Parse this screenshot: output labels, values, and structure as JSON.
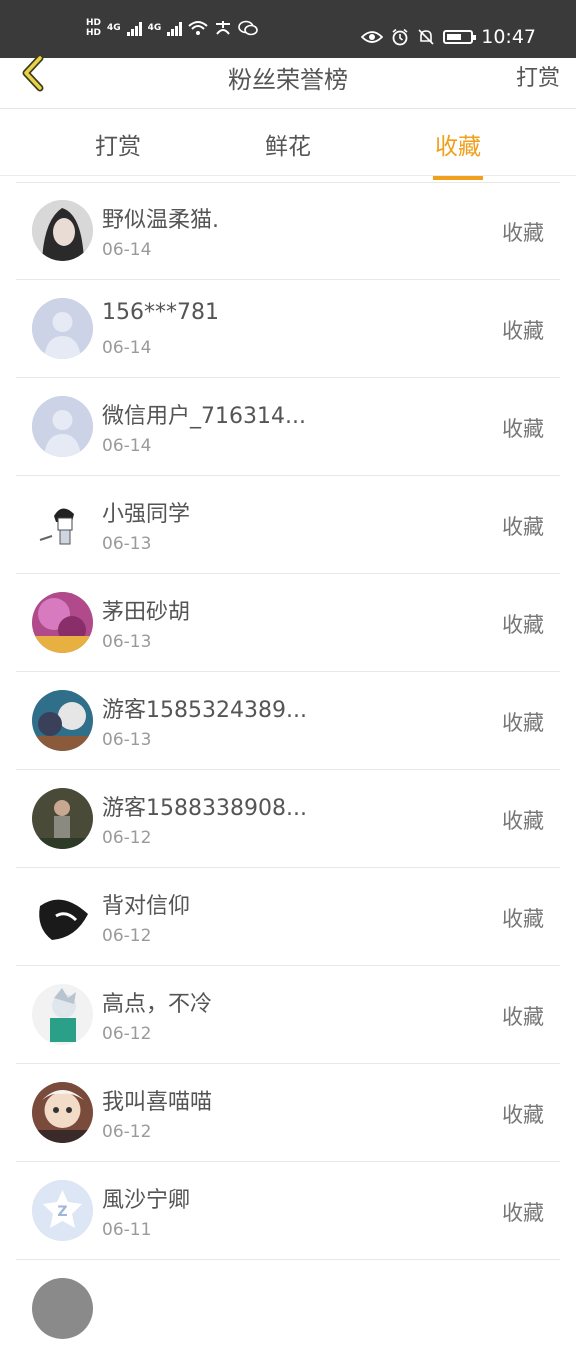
{
  "status_bar": {
    "hd_top": "HD",
    "hd_bottom": "HD",
    "net1": "4G",
    "net2": "4G",
    "time": "10:47"
  },
  "header": {
    "title": "粉丝荣誉榜",
    "action": "打赏"
  },
  "tabs": [
    {
      "label": "打赏",
      "active": false
    },
    {
      "label": "鲜花",
      "active": false
    },
    {
      "label": "收藏",
      "active": true
    }
  ],
  "list": [
    {
      "name": "野似温柔猫.",
      "date": "06-14",
      "action": "收藏"
    },
    {
      "name": "156***781",
      "date": "06-14",
      "action": "收藏"
    },
    {
      "name": "微信用户_716314...",
      "date": "06-14",
      "action": "收藏"
    },
    {
      "name": "小强同学",
      "date": "06-13",
      "action": "收藏"
    },
    {
      "name": "茅田砂胡",
      "date": "06-13",
      "action": "收藏"
    },
    {
      "name": "游客1585324389...",
      "date": "06-13",
      "action": "收藏"
    },
    {
      "name": "游客1588338908...",
      "date": "06-12",
      "action": "收藏"
    },
    {
      "name": "背对信仰",
      "date": "06-12",
      "action": "收藏"
    },
    {
      "name": "高点，不冷",
      "date": "06-12",
      "action": "收藏"
    },
    {
      "name": "我叫喜喵喵",
      "date": "06-12",
      "action": "收藏"
    },
    {
      "name": "風沙宁卿",
      "date": "06-11",
      "action": "收藏"
    }
  ],
  "colors": {
    "accent": "#f0a01c",
    "status_bar": "#3a3a3a"
  }
}
